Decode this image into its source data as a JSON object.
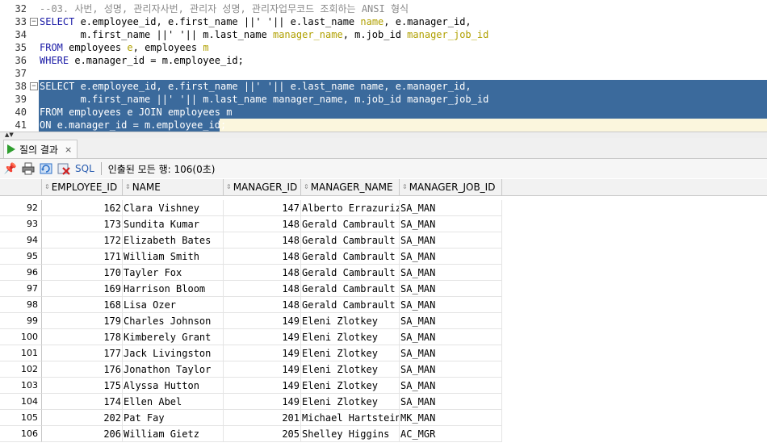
{
  "editor": {
    "lines": [
      {
        "n": "32",
        "fold": "",
        "parts": [
          {
            "t": "--03. 사번, 성명, 관리자사번, 관리자 성명, 관리자업무코드 조회하는 ANSI 형식",
            "c": "cm"
          }
        ]
      },
      {
        "n": "33",
        "fold": "⊟",
        "parts": [
          {
            "t": "SELECT",
            "c": "kw"
          },
          {
            "t": " e.employee_id, e.first_name ||' '|| e.last_name ",
            "c": ""
          },
          {
            "t": "name",
            "c": "al"
          },
          {
            "t": ", e.manager_id,",
            "c": ""
          }
        ]
      },
      {
        "n": "34",
        "fold": "",
        "parts": [
          {
            "t": "       m.first_name ||' '|| m.last_name ",
            "c": ""
          },
          {
            "t": "manager_name",
            "c": "al"
          },
          {
            "t": ", m.job_id ",
            "c": ""
          },
          {
            "t": "manager_job_id",
            "c": "al"
          }
        ]
      },
      {
        "n": "35",
        "fold": "",
        "parts": [
          {
            "t": "FROM",
            "c": "kw"
          },
          {
            "t": " employees ",
            "c": ""
          },
          {
            "t": "e",
            "c": "al"
          },
          {
            "t": ", employees ",
            "c": ""
          },
          {
            "t": "m",
            "c": "al"
          }
        ]
      },
      {
        "n": "36",
        "fold": "",
        "parts": [
          {
            "t": "WHERE",
            "c": "kw"
          },
          {
            "t": " e.manager_id = m.employee_id;",
            "c": ""
          }
        ]
      },
      {
        "n": "37",
        "fold": "",
        "parts": []
      },
      {
        "n": "38",
        "fold": "⊟",
        "parts": [
          {
            "t": "SELECT e.employee_id, e.first_name ||' '|| e.last_name name, e.manager_id,",
            "c": ""
          }
        ]
      },
      {
        "n": "39",
        "fold": "",
        "parts": [
          {
            "t": "       m.first_name ||' '|| m.last_name manager_name, m.job_id manager_job_id",
            "c": ""
          }
        ]
      },
      {
        "n": "40",
        "fold": "",
        "parts": [
          {
            "t": "FROM employees e JOIN employees m",
            "c": ""
          }
        ]
      },
      {
        "n": "41",
        "fold": "",
        "parts": [
          {
            "t": "ON e.manager_id = m.employee_id;",
            "c": ""
          }
        ]
      }
    ]
  },
  "result_tab": {
    "label": "질의 결과",
    "close": "×"
  },
  "toolbar": {
    "sql_label": "SQL",
    "status": "인출된 모든 행: 106(0초)"
  },
  "grid": {
    "columns": [
      "EMPLOYEE_ID",
      "NAME",
      "MANAGER_ID",
      "MANAGER_NAME",
      "MANAGER_JOB_ID"
    ],
    "rows": [
      [
        "92",
        "162",
        "Clara Vishney",
        "147",
        "Alberto Errazuriz",
        "SA_MAN"
      ],
      [
        "93",
        "173",
        "Sundita Kumar",
        "148",
        "Gerald Cambrault",
        "SA_MAN"
      ],
      [
        "94",
        "172",
        "Elizabeth Bates",
        "148",
        "Gerald Cambrault",
        "SA_MAN"
      ],
      [
        "95",
        "171",
        "William Smith",
        "148",
        "Gerald Cambrault",
        "SA_MAN"
      ],
      [
        "96",
        "170",
        "Tayler Fox",
        "148",
        "Gerald Cambrault",
        "SA_MAN"
      ],
      [
        "97",
        "169",
        "Harrison Bloom",
        "148",
        "Gerald Cambrault",
        "SA_MAN"
      ],
      [
        "98",
        "168",
        "Lisa Ozer",
        "148",
        "Gerald Cambrault",
        "SA_MAN"
      ],
      [
        "99",
        "179",
        "Charles Johnson",
        "149",
        "Eleni Zlotkey",
        "SA_MAN"
      ],
      [
        "100",
        "178",
        "Kimberely Grant",
        "149",
        "Eleni Zlotkey",
        "SA_MAN"
      ],
      [
        "101",
        "177",
        "Jack Livingston",
        "149",
        "Eleni Zlotkey",
        "SA_MAN"
      ],
      [
        "102",
        "176",
        "Jonathon Taylor",
        "149",
        "Eleni Zlotkey",
        "SA_MAN"
      ],
      [
        "103",
        "175",
        "Alyssa Hutton",
        "149",
        "Eleni Zlotkey",
        "SA_MAN"
      ],
      [
        "104",
        "174",
        "Ellen Abel",
        "149",
        "Eleni Zlotkey",
        "SA_MAN"
      ],
      [
        "105",
        "202",
        "Pat Fay",
        "201",
        "Michael Hartstein",
        "MK_MAN"
      ],
      [
        "106",
        "206",
        "William Gietz",
        "205",
        "Shelley Higgins",
        "AC_MGR"
      ]
    ]
  }
}
